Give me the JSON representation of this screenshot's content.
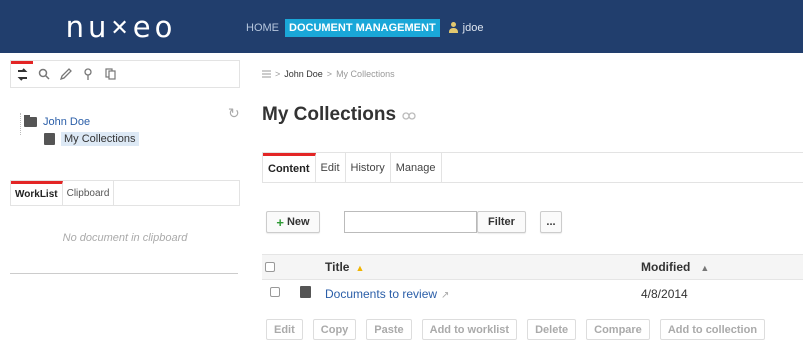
{
  "header": {
    "logo": "nu",
    "logo_mark": "✕",
    "logo_tail": "eo",
    "nav_home": "HOME",
    "nav_active": "DOCUMENT MANAGEMENT",
    "username": "jdoe"
  },
  "left": {
    "tab_icons": [
      "sync-icon",
      "search-icon",
      "tag-icon",
      "pin-icon",
      "copy-icon"
    ],
    "tree": {
      "root_label": "John Doe",
      "child_label": "My Collections"
    },
    "worklist_tabs": [
      "WorkList",
      "Clipboard"
    ],
    "empty_message": "No document in clipboard"
  },
  "main": {
    "breadcrumb": {
      "sep": ">",
      "items": [
        "John Doe",
        "My Collections"
      ]
    },
    "title": "My Collections",
    "tabs": [
      "Content",
      "Edit",
      "History",
      "Manage"
    ],
    "toolbar": {
      "new_label": "New",
      "filter_label": "Filter",
      "more_label": "...",
      "filter_value": ""
    },
    "table": {
      "headers": {
        "title": "Title",
        "modified": "Modified"
      },
      "rows": [
        {
          "title": "Documents to review",
          "modified": "4/8/2014"
        }
      ]
    },
    "actions": [
      "Edit",
      "Copy",
      "Paste",
      "Add to worklist",
      "Delete",
      "Compare",
      "Add to collection"
    ]
  },
  "colors": {
    "header_bg": "#213e6d",
    "accent": "#1aa7d8",
    "tab_indicator": "#e32525",
    "link": "#2a5ea8"
  }
}
